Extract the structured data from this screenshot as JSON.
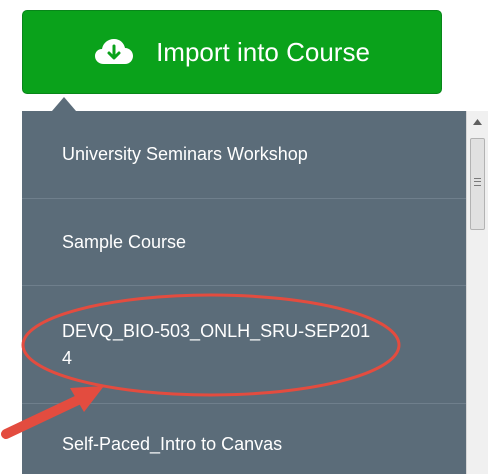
{
  "import_button": {
    "label": "Import into Course",
    "icon": "cloud-download-icon",
    "color": "#0aa21b"
  },
  "dropdown": {
    "background": "#5b6c79",
    "items": [
      {
        "label": "University Seminars Workshop"
      },
      {
        "label": "Sample Course"
      },
      {
        "label": "DEVQ_BIO-503_ONLH_SRU-SEP2014",
        "highlighted": true
      },
      {
        "label": "Self-Paced_Intro to Canvas"
      }
    ]
  },
  "annotation": {
    "color": "#e34c3f",
    "shapes": [
      "highlight-ellipse",
      "pointer-arrow"
    ]
  }
}
